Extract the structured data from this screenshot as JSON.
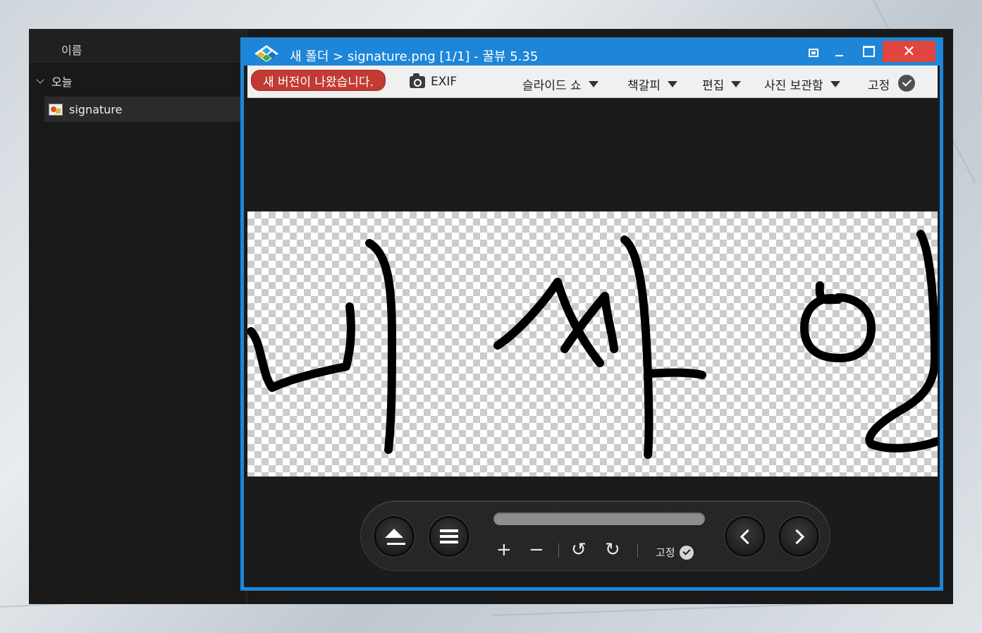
{
  "explorer": {
    "column_header": "이름",
    "group_label": "오늘",
    "files": [
      {
        "name": "signature",
        "icon": "image-file-icon"
      }
    ]
  },
  "viewer": {
    "title": "새 폴더 > signature.png [1/1] - 꿀뷰 5.35",
    "accent_color": "#1e86d8",
    "close_color": "#e0453e",
    "titlebar_buttons": {
      "close": "✕"
    },
    "toolbar": {
      "update_notice": "새 버전이 나왔습니다.",
      "exif": "EXIF",
      "slideshow": "슬라이드 쇼",
      "bookmark": "책갈피",
      "edit": "편집",
      "photo_archive": "사진 보관함",
      "pin": "고정"
    },
    "image": {
      "filename": "signature.png",
      "background": "transparent-checkerboard"
    },
    "controls": {
      "zoom_in": "+",
      "zoom_out": "−",
      "rotate_left": "↺",
      "rotate_right": "↻",
      "pin": "고정"
    }
  }
}
